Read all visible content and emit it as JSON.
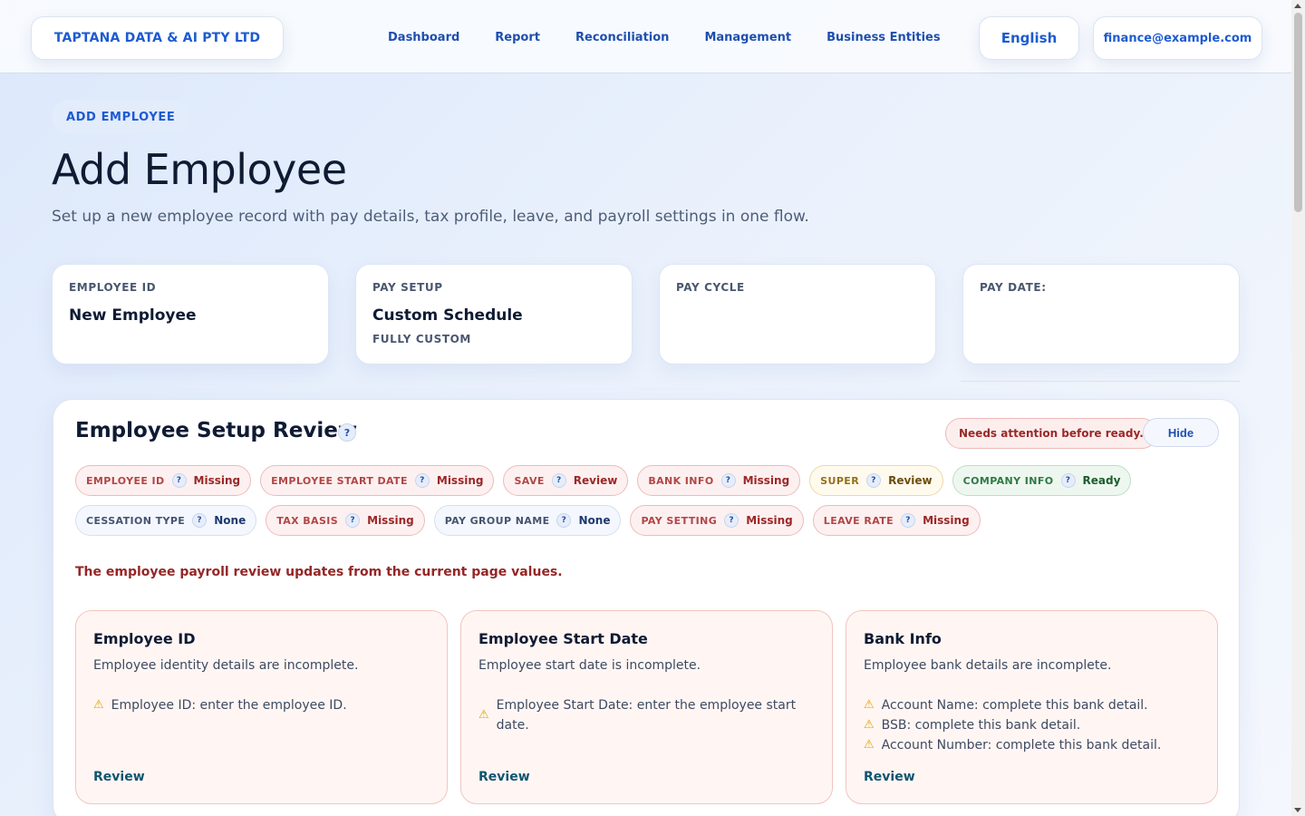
{
  "header": {
    "company": "TAPTANA DATA & AI PTY LTD",
    "nav": [
      "Dashboard",
      "Report",
      "Reconciliation",
      "Management",
      "Business Entities"
    ],
    "language": "English",
    "user_email": "finance@example.com"
  },
  "hero": {
    "pill": "ADD EMPLOYEE",
    "title": "Add Employee",
    "subtitle": "Set up a new employee record with pay details, tax profile, leave, and payroll settings in one flow."
  },
  "stats": [
    {
      "label": "EMPLOYEE ID",
      "value": "New Employee",
      "sub": ""
    },
    {
      "label": "PAY SETUP",
      "value": "Custom Schedule",
      "sub": "FULLY CUSTOM"
    },
    {
      "label": "PAY CYCLE",
      "value": "",
      "sub": ""
    },
    {
      "label": "PAY DATE:",
      "value": "",
      "sub": ""
    }
  ],
  "review": {
    "title": "Employee Setup Review",
    "help_glyph": "?",
    "attention": "Needs attention before ready.",
    "hide_label": "Hide",
    "chips_row1": [
      {
        "label": "EMPLOYEE ID",
        "status": "Missing",
        "kind": "missing"
      },
      {
        "label": "EMPLOYEE START DATE",
        "status": "Missing",
        "kind": "missing"
      },
      {
        "label": "SAVE",
        "status": "Review",
        "kind": "missing"
      },
      {
        "label": "BANK INFO",
        "status": "Missing",
        "kind": "missing"
      },
      {
        "label": "SUPER",
        "status": "Review",
        "kind": "review"
      },
      {
        "label": "COMPANY INFO",
        "status": "Ready",
        "kind": "ready"
      }
    ],
    "chips_row2": [
      {
        "label": "CESSATION TYPE",
        "status": "None",
        "kind": "none"
      },
      {
        "label": "TAX BASIS",
        "status": "Missing",
        "kind": "missing"
      },
      {
        "label": "PAY GROUP NAME",
        "status": "None",
        "kind": "none"
      },
      {
        "label": "PAY SETTING",
        "status": "Missing",
        "kind": "missing"
      },
      {
        "label": "LEAVE RATE",
        "status": "Missing",
        "kind": "missing"
      }
    ],
    "note": "The employee payroll review updates from the current page values.",
    "issues": [
      {
        "title": "Employee ID",
        "desc": "Employee identity details are incomplete.",
        "items": [
          "Employee ID: enter the employee ID."
        ],
        "action": "Review"
      },
      {
        "title": "Employee Start Date",
        "desc": "Employee start date is incomplete.",
        "items": [
          "Employee Start Date: enter the employee start date."
        ],
        "action": "Review"
      },
      {
        "title": "Bank Info",
        "desc": "Employee bank details are incomplete.",
        "items": [
          "Account Name: complete this bank detail.",
          "BSB: complete this bank detail.",
          "Account Number: complete this bank detail."
        ],
        "action": "Review"
      }
    ]
  },
  "icons": {
    "help": "help-icon",
    "warning": "warning-icon"
  },
  "colors": {
    "accent": "#1d5bd0",
    "missing": "#9b2727",
    "review": "#6b4d07",
    "ready": "#1c5c2f"
  }
}
